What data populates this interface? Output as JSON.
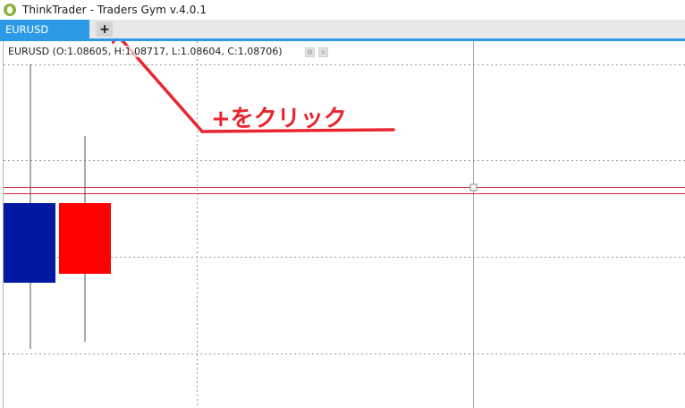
{
  "window": {
    "title": "ThinkTrader - Traders Gym v.4.0.1",
    "icon": "thinktrader-logo-icon"
  },
  "tabs": [
    {
      "label": "EURUSD",
      "active": true
    }
  ],
  "add_tab_label": "+",
  "chart": {
    "ohlc_text": "EURUSD (O:1.08605, H:1.08717, L:1.08604, C:1.08706)",
    "colors": {
      "bull": "#0019a0",
      "bear": "#ff0000",
      "price_line": "#d0302f",
      "accent": "#2d9ae8"
    }
  },
  "annotation": {
    "text": "+をクリック",
    "color": "#e8262f"
  },
  "chart_data": {
    "type": "candlestick",
    "series": [
      {
        "open": 1.08605,
        "high": 1.08717,
        "low": 1.08604,
        "close": 1.08706
      }
    ]
  }
}
